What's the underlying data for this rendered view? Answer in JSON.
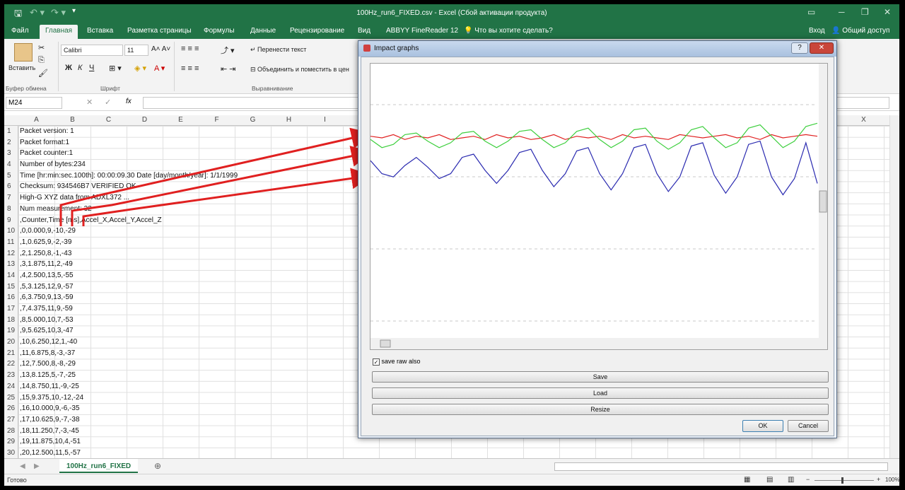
{
  "app": {
    "title": "100Hz_run6_FIXED.csv - Excel (Сбой активации продукта)",
    "colors": {
      "excel_green": "#217346",
      "dialog_bg": "#f0f0f0"
    }
  },
  "ribbon_tabs": [
    "Файл",
    "Главная",
    "Вставка",
    "Разметка страницы",
    "Формулы",
    "Данные",
    "Рецензирование",
    "Вид",
    "ABBYY FineReader 12"
  ],
  "tell_me": "Что вы хотите сделать?",
  "account": {
    "signin": "Вход",
    "share": "Общий доступ"
  },
  "ribbon": {
    "paste": "Вставить",
    "font_name": "Calibri",
    "font_size": "11",
    "bold": "Ж",
    "italic": "К",
    "underline": "Ч",
    "wrap_text": "Перенести текст",
    "merge_center": "Объединить и поместить в цен",
    "groups": {
      "clipboard": "Буфер обмена",
      "font": "Шрифт",
      "alignment": "Выравнивание"
    }
  },
  "formula_bar": {
    "name_box": "M24",
    "fx": "fx",
    "content": ""
  },
  "columns": [
    "A",
    "B",
    "C",
    "D",
    "E",
    "F",
    "G",
    "H",
    "I",
    "X"
  ],
  "rows": [
    {
      "n": "1",
      "a": "Packet version: 1"
    },
    {
      "n": "2",
      "a": "Packet format:1"
    },
    {
      "n": "3",
      "a": "Packet counter:1"
    },
    {
      "n": "4",
      "a": "Number of bytes:234"
    },
    {
      "n": "5",
      "a": "Time [hr:min:sec.100th]: 00:00:09.30 Date [day/month/year]: 1/1/1999"
    },
    {
      "n": "6",
      "a": "Checksum: 934546B7 VERIFIED OK"
    },
    {
      "n": "7",
      "a": "High-G XYZ data from ADXL372 ..."
    },
    {
      "n": "8",
      "a": "Num measurement: 32"
    },
    {
      "n": "9",
      "a": ",Counter,Time [ms],Accel_X,Accel_Y,Accel_Z"
    },
    {
      "n": "10",
      "a": ",0,0.000,9,-10,-29"
    },
    {
      "n": "11",
      "a": ",1,0.625,9,-2,-39"
    },
    {
      "n": "12",
      "a": ",2,1.250,8,-1,-43"
    },
    {
      "n": "13",
      "a": ",3,1.875,11,2,-49"
    },
    {
      "n": "14",
      "a": ",4,2.500,13,5,-55"
    },
    {
      "n": "15",
      "a": ",5,3.125,12,9,-57"
    },
    {
      "n": "16",
      "a": ",6,3.750,9,13,-59"
    },
    {
      "n": "17",
      "a": ",7,4.375,11,9,-59"
    },
    {
      "n": "18",
      "a": ",8,5.000,10,7,-53"
    },
    {
      "n": "19",
      "a": ",9,5.625,10,3,-47"
    },
    {
      "n": "20",
      "a": ",10,6.250,12,1,-40"
    },
    {
      "n": "21",
      "a": ",11,6.875,8,-3,-37"
    },
    {
      "n": "22",
      "a": ",12,7.500,8,-8,-29"
    },
    {
      "n": "23",
      "a": ",13,8.125,5,-7,-25"
    },
    {
      "n": "24",
      "a": ",14,8.750,11,-9,-25"
    },
    {
      "n": "25",
      "a": ",15,9.375,10,-12,-24"
    },
    {
      "n": "26",
      "a": ",16,10.000,9,-6,-35"
    },
    {
      "n": "27",
      "a": ",17,10.625,9,-7,-38"
    },
    {
      "n": "28",
      "a": ",18,11.250,7,-3,-45"
    },
    {
      "n": "29",
      "a": ",19,11.875,10,4,-51"
    },
    {
      "n": "30",
      "a": ",20,12.500,11,5,-57"
    }
  ],
  "sheet_tab": "100Hz_run6_FIXED",
  "status": {
    "ready": "Готово",
    "zoom": "100%"
  },
  "dialog": {
    "title": "Impact graphs",
    "checkbox_label": "save raw also",
    "checkbox_checked": true,
    "buttons": {
      "save": "Save",
      "load": "Load",
      "resize": "Resize",
      "ok": "OK",
      "cancel": "Cancel"
    }
  },
  "chart_data": {
    "type": "line",
    "grid": "dashed horizontal",
    "legend": "none",
    "series": [
      {
        "color": "#e02020",
        "values": [
          1,
          0,
          2,
          -1,
          1,
          0,
          2,
          -1,
          0,
          1,
          -1,
          2,
          0,
          1,
          -1,
          0,
          2,
          -1,
          1,
          0,
          1,
          -1,
          2,
          0,
          1,
          0,
          -1,
          2,
          1,
          0,
          1,
          2,
          0,
          1,
          -1,
          2,
          0,
          1,
          2,
          1
        ]
      },
      {
        "color": "#3ecf3e",
        "values": [
          -1,
          -6,
          -4,
          2,
          3,
          -2,
          -6,
          -3,
          3,
          4,
          -2,
          -6,
          -2,
          4,
          5,
          -1,
          -6,
          -3,
          4,
          6,
          -1,
          -6,
          -2,
          5,
          6,
          -2,
          -7,
          -3,
          5,
          7,
          0,
          -6,
          -3,
          6,
          8,
          1,
          -6,
          -2,
          7,
          9
        ]
      },
      {
        "color": "#2a2ab0",
        "values": [
          -14,
          -22,
          -24,
          -17,
          -12,
          -18,
          -25,
          -22,
          -12,
          -10,
          -20,
          -28,
          -20,
          -9,
          -7,
          -20,
          -30,
          -22,
          -8,
          -6,
          -22,
          -32,
          -22,
          -6,
          -4,
          -22,
          -33,
          -24,
          -5,
          -3,
          -23,
          -34,
          -24,
          -4,
          -2,
          -24,
          -35,
          -25,
          -3,
          -28
        ]
      }
    ]
  }
}
